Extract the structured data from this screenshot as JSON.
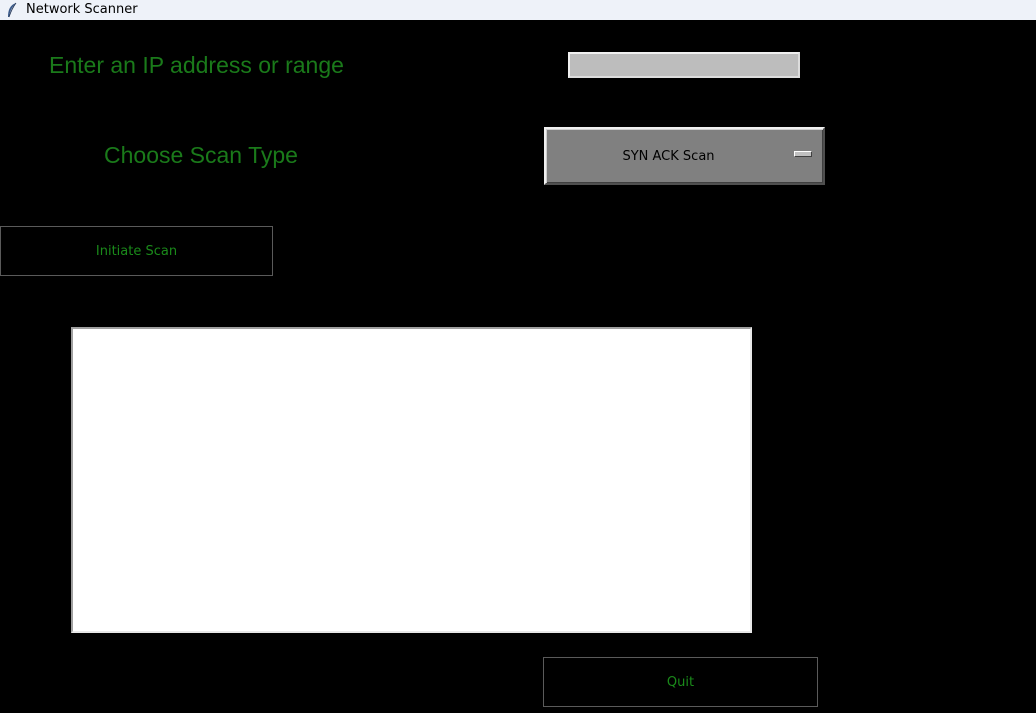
{
  "window": {
    "title": "Network Scanner",
    "icon": "feather-icon"
  },
  "form": {
    "ip_label": "Enter an IP address or range",
    "ip_value": "",
    "scan_type_label": "Choose Scan Type",
    "scan_type_selected": "SYN ACK Scan",
    "initiate_label": "Initiate Scan",
    "quit_label": "Quit"
  },
  "output": {
    "text": ""
  },
  "colors": {
    "background": "#000000",
    "label_green": "#1a7a1a",
    "titlebar": "#eef2f9"
  }
}
